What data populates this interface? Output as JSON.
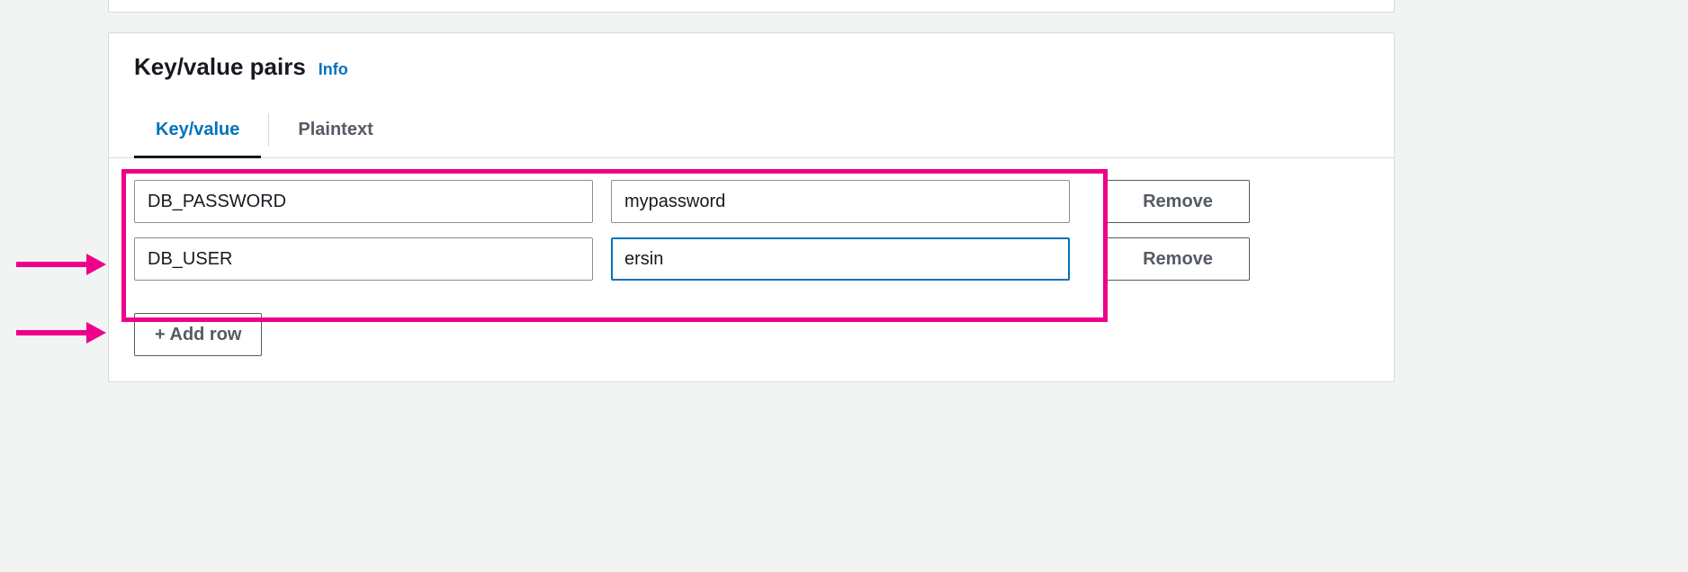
{
  "panel": {
    "title": "Key/value pairs",
    "info_label": "Info"
  },
  "tabs": {
    "keyvalue": "Key/value",
    "plaintext": "Plaintext"
  },
  "rows": [
    {
      "key": "DB_PASSWORD",
      "value": "mypassword"
    },
    {
      "key": "DB_USER",
      "value": "ersin"
    }
  ],
  "buttons": {
    "remove": "Remove",
    "add_row": "+ Add row"
  },
  "colors": {
    "accent": "#0073bb",
    "highlight": "#ec008c"
  }
}
